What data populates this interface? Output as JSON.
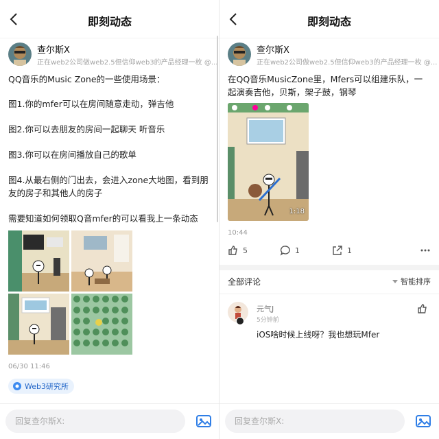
{
  "header": {
    "title": "即刻动态"
  },
  "author": {
    "name": "查尔斯X",
    "bio": "正在web2公司做web2.5但信仰web3的产品经理一枚 @..."
  },
  "left_post": {
    "lines": [
      "QQ音乐的Music Zone的一些使用场景：",
      "图1.你的mfer可以在房间随意走动，弹吉他",
      "图2.你可以去朋友的房间一起聊天 听音乐",
      "图3.你可以在房间播放自己的歌单",
      "图4.从最右侧的门出去，会进入zone大地图，看到朋",
      "友的房子和其他人的房子",
      "需要知道如何领取Q音mfer的可以看我上一条动态"
    ],
    "time": "06/30 11:46",
    "tag": "Web3研究所"
  },
  "right_post": {
    "lines": [
      "在QQ音乐MusicZone里，Mfers可以组建乐队，一",
      "起演奏吉他，贝斯，架子鼓，钢琴"
    ],
    "video_duration": "1:18",
    "time": "10:44",
    "actions": {
      "likes": "5",
      "comments": "1",
      "shares": "1"
    }
  },
  "comments_section": {
    "title": "全部评论",
    "sort": "智能排序"
  },
  "comment": {
    "user": "元气J",
    "time": "5分钟前",
    "text": "iOS啥时候上线呀？我也想玩Mfer"
  },
  "reply": {
    "placeholder": "回复查尔斯X:"
  },
  "colors": {
    "accent": "#2366c8",
    "divider": "#f3f3f3"
  }
}
